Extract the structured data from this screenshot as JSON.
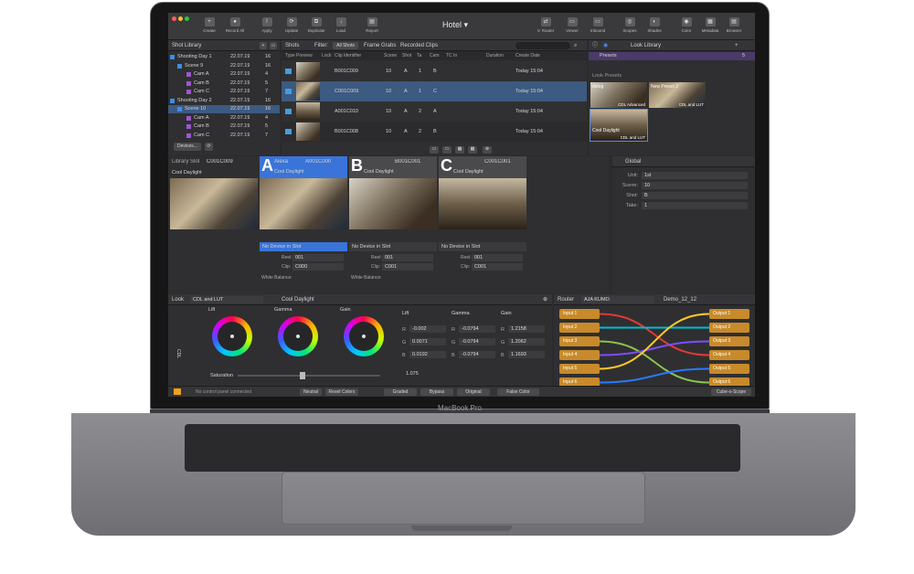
{
  "device": {
    "label": "MacBook Pro"
  },
  "app": {
    "title": "Hotel ▾"
  },
  "toolbar": {
    "left": [
      {
        "label": "Create"
      },
      {
        "label": "Record All"
      }
    ],
    "center": [
      {
        "label": "Apply"
      },
      {
        "label": "Update"
      },
      {
        "label": "Duplicate"
      },
      {
        "label": "Load"
      },
      {
        "label": "Report"
      }
    ],
    "right": [
      {
        "label": "V. Router"
      },
      {
        "label": "Viewer"
      },
      {
        "label": "Inbound"
      },
      {
        "label": "Scopes"
      },
      {
        "label": "Shades"
      },
      {
        "label": "Color"
      },
      {
        "label": "Metadata"
      },
      {
        "label": "Browser"
      }
    ]
  },
  "shot_library": {
    "title": "Shot Library",
    "rows": [
      {
        "name": "Shooting Day 1",
        "date": "22.07.19",
        "count": "16"
      },
      {
        "name": "Scene 9",
        "date": "22.07.19",
        "count": "16"
      },
      {
        "name": "Cam A",
        "date": "22.07.19",
        "count": "4"
      },
      {
        "name": "Cam B",
        "date": "22.07.19",
        "count": "5"
      },
      {
        "name": "Cam C",
        "date": "22.07.19",
        "count": "7"
      },
      {
        "name": "Shooting Day 2",
        "date": "22.07.19",
        "count": "16"
      },
      {
        "name": "Scene 10",
        "date": "22.07.19",
        "count": "16"
      },
      {
        "name": "Cam A",
        "date": "22.07.19",
        "count": "4"
      },
      {
        "name": "Cam B",
        "date": "22.07.19",
        "count": "5"
      },
      {
        "name": "Cam C",
        "date": "22.07.19",
        "count": "7"
      }
    ],
    "devices_button": "Devices..."
  },
  "shots": {
    "title": "Shots",
    "filter_label": "Filter:",
    "filters": [
      "All Shots",
      "Frame Grabs",
      "Recorded Clips"
    ],
    "columns": [
      "Type",
      "Preview",
      "Lock",
      "Clip Identifier",
      "Scene",
      "Shot",
      "Ta",
      "Cam",
      "TC In",
      "Duration",
      "Create Date"
    ],
    "rows": [
      {
        "clip": "B001C009",
        "scene": "10",
        "shot": "A",
        "take": "1",
        "cam": "B",
        "date": "Today 15:04"
      },
      {
        "clip": "C001C009",
        "scene": "10",
        "shot": "A",
        "take": "1",
        "cam": "C",
        "date": "Today 15:04"
      },
      {
        "clip": "A001C010",
        "scene": "10",
        "shot": "A",
        "take": "2",
        "cam": "A",
        "date": "Today 15:04"
      },
      {
        "clip": "B001C008",
        "scene": "10",
        "shot": "A",
        "take": "2",
        "cam": "B",
        "date": "Today 15:04"
      }
    ]
  },
  "look_library": {
    "title": "Look Library",
    "presets_label": "Presets",
    "presets_count": "5",
    "look_presets_label": "Look Presets",
    "items": [
      {
        "name": "delog",
        "tag": "CDL Advanced"
      },
      {
        "name": "New Preset 2",
        "tag": "CDL and LUT"
      },
      {
        "name": "Cool Daylight",
        "tag": "CDL and LUT"
      }
    ]
  },
  "library_slot": {
    "title": "Library Slot",
    "clip": "C001C009",
    "look": "Cool Daylight"
  },
  "slots": [
    {
      "letter": "A",
      "name": "Alexa",
      "clip": "A001C000",
      "look": "Cool Daylight",
      "device": "No Device in Slot",
      "reel": "001",
      "clip_field": "C000",
      "wb_label": "White Balance:"
    },
    {
      "letter": "B",
      "name": "",
      "clip": "B001C001",
      "look": "Cool Daylight",
      "device": "No Device in Slot",
      "reel": "001",
      "clip_field": "C001",
      "wb_label": "White Balance:"
    },
    {
      "letter": "C",
      "name": "",
      "clip": "C001C001",
      "look": "Cool Daylight",
      "device": "No Device in Slot",
      "reel": "001",
      "clip_field": "C001",
      "wb_label": ""
    }
  ],
  "field_labels": {
    "reel": "Reel:",
    "clip": "Clip:"
  },
  "global": {
    "title": "Global",
    "fields": [
      {
        "label": "Unit:",
        "value": "1st"
      },
      {
        "label": "Scene:",
        "value": "10"
      },
      {
        "label": "Shot:",
        "value": "B"
      },
      {
        "label": "Take:",
        "value": "1"
      }
    ]
  },
  "look": {
    "label": "Look",
    "mode": "CDL and LUT",
    "name": "Cool Daylight",
    "cdl_label": "CDL",
    "wheels": [
      "Lift",
      "Gamma",
      "Gain"
    ],
    "values": {
      "lift": [
        "-0.002",
        "0.0071",
        "0.0192"
      ],
      "gamma": [
        "-0.0794",
        "-0.0794",
        "-0.0794"
      ],
      "gain": [
        "1.2158",
        "1.2062",
        "1.1693"
      ]
    },
    "channels": [
      "R",
      "G",
      "B"
    ],
    "saturation_label": "Saturation",
    "saturation_value": "1.075",
    "saturation_level": 0.45
  },
  "router": {
    "label": "Router",
    "device": "AJA KUMO",
    "preset": "Demo_12_12",
    "inputs": [
      "Input 1",
      "Input 2",
      "Input 3",
      "Input 4",
      "Input 5",
      "Input 6"
    ],
    "outputs": [
      "Output 1",
      "Output 2",
      "Output 3",
      "Output 4",
      "Output 5",
      "Output 6"
    ],
    "colors": [
      "#e53935",
      "#00bcd4",
      "#8bc34a",
      "#7c4dff",
      "#ffca28",
      "#2979ff"
    ]
  },
  "bottom_bar": {
    "status": "No control panel connected",
    "neutral": "Neutral",
    "reset": "Reset Colors",
    "graded": "Graded",
    "bypass": "Bypass",
    "original": "Original",
    "false_color": "False Color",
    "scope": "Cube-o-Scope"
  }
}
